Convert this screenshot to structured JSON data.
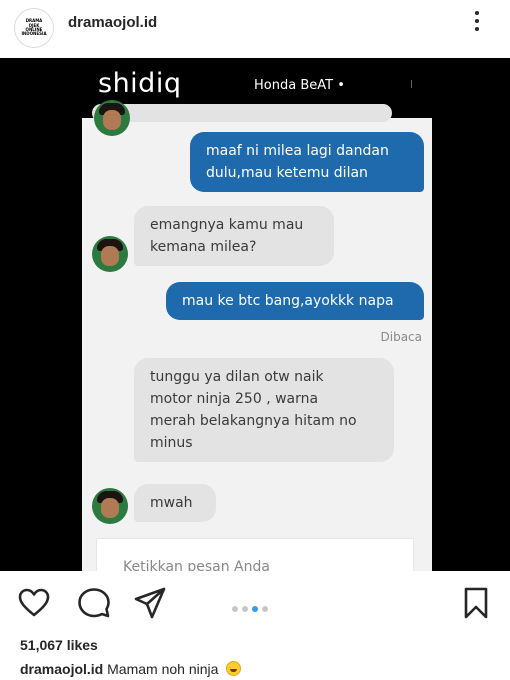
{
  "header": {
    "username": "dramaojol.id",
    "avatar_text": [
      "DRAMA",
      "OJEK",
      "ONLINE",
      "INDONESIA"
    ],
    "avatar_icon": "brand-logo",
    "more_icon": "more-vertical-icon"
  },
  "post": {
    "app_header": {
      "driver_name": "shidiq",
      "vehicle": "Honda BeAT •"
    },
    "messages": [
      {
        "from": "user",
        "text_lines": [
          "maaf ni milea lagi dandan",
          "dulu,mau ketemu dilan"
        ]
      },
      {
        "from": "driver",
        "text_lines": [
          "emangnya kamu mau",
          "kemana milea?"
        ]
      },
      {
        "from": "user",
        "text_lines": [
          "mau ke btc bang,ayokkk napa"
        ]
      },
      {
        "from": "driver",
        "text_lines": [
          "tunggu ya dilan otw naik",
          "motor ninja 250 , warna",
          "merah belakangnya hitam no",
          "minus"
        ]
      },
      {
        "from": "driver",
        "text_lines": [
          "mwah"
        ]
      }
    ],
    "read_status": "Dibaca",
    "input_placeholder": "Ketikkan pesan Anda",
    "colors": {
      "outgoing": "#1e6aad",
      "incoming": "#e3e3e3",
      "background": "#f2f2f2"
    }
  },
  "actions": {
    "like_icon": "heart-icon",
    "comment_icon": "comment-icon",
    "share_icon": "send-icon",
    "save_icon": "bookmark-icon",
    "carousel": {
      "count": 4,
      "active": 3
    }
  },
  "likes": "51,067 likes",
  "caption": {
    "username": "dramaojol.id",
    "text": "Mamam noh ninja",
    "emoji": "grinning-sweat-emoji"
  }
}
